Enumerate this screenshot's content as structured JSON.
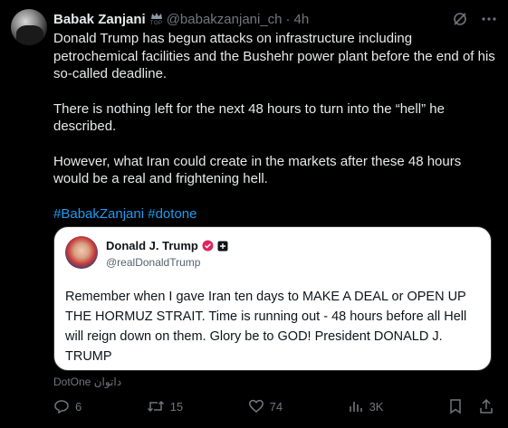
{
  "post": {
    "author_name": "Babak Zanjani",
    "badge_label": "TOP",
    "handle": "@babakzanjani_ch",
    "separator": "·",
    "time": "4h",
    "paragraphs": [
      "Donald Trump has begun attacks on infrastructure including petrochemical facilities and the Bushehr power plant before the end of his so-called deadline.",
      "There is nothing left for the next 48 hours to turn into the “hell” he described.",
      "However, what Iran could create in the markets after these 48 hours would be a real and frightening hell."
    ],
    "hashtags": [
      "#BabakZanjani",
      "#dotone"
    ]
  },
  "quote": {
    "author_name": "Donald J. Trump",
    "handle": "@realDonaldTrump",
    "text": "Remember when I gave Iran ten days to MAKE A DEAL or OPEN UP THE HORMUZ STRAIT. Time is running out - 48 hours before all Hell will reign down on them. Glory be to GOD! President DONALD J. TRUMP"
  },
  "quote_label": "DotOne داتوان",
  "actions": {
    "replies": "6",
    "reposts": "15",
    "likes": "74",
    "views": "3K"
  },
  "colors": {
    "background": "#000000",
    "text": "#e7e9ea",
    "muted": "#71767b",
    "link": "#1d9bf0",
    "quote_background": "#ffffff",
    "verified_pink": "#e0245e"
  },
  "icons": [
    "grok-icon",
    "more-icon",
    "reply-icon",
    "repost-icon",
    "like-icon",
    "views-icon",
    "bookmark-icon",
    "share-icon",
    "verified-badge-icon",
    "affiliate-badge-icon"
  ]
}
